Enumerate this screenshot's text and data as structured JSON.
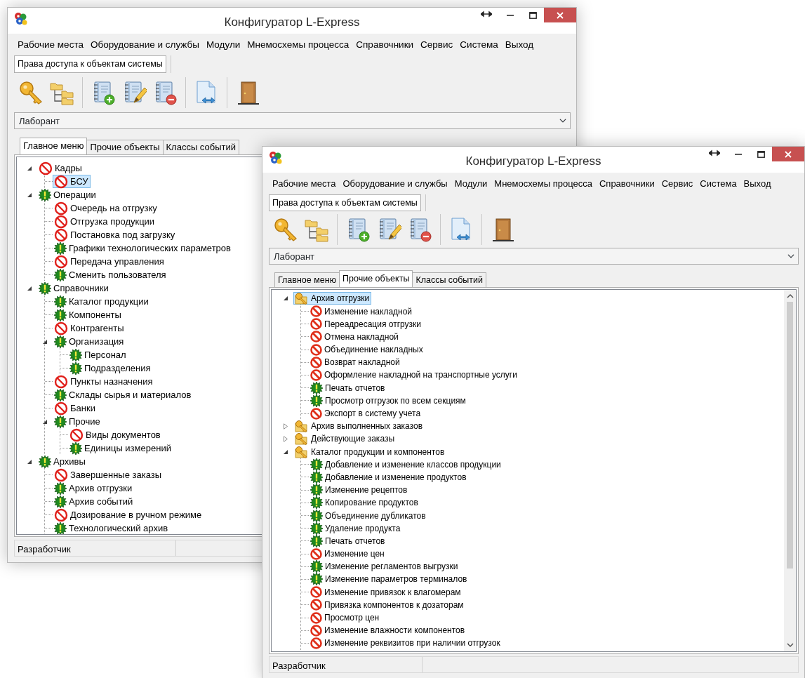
{
  "windows": [
    {
      "title": "Конфигуратор L-Express",
      "menu": [
        "Рабочие места",
        "Оборудование и службы",
        "Модули",
        "Мнемосхемы процесса",
        "Справочники",
        "Сервис",
        "Система",
        "Выход"
      ],
      "doc_tabs": [
        "Права доступа к объектам системы"
      ],
      "role": "Лаборант",
      "tabs": [
        {
          "label": "Главное меню",
          "selected": true
        },
        {
          "label": "Прочие объекты",
          "selected": false
        },
        {
          "label": "Классы событий",
          "selected": false
        }
      ],
      "tree": [
        {
          "label": "Кадры",
          "kind": "denied",
          "selected": false,
          "expanded": true,
          "children": [
            {
              "label": "БСУ",
              "kind": "denied",
              "selected": true
            }
          ]
        },
        {
          "label": "Операции",
          "kind": "allowed",
          "selected": false,
          "expanded": true,
          "children": [
            {
              "label": "Очередь на отгрузку",
              "kind": "denied",
              "selected": false
            },
            {
              "label": "Отгрузка продукции",
              "kind": "denied",
              "selected": false
            },
            {
              "label": "Постановка под загрузку",
              "kind": "denied",
              "selected": false
            },
            {
              "label": "Графики технологических параметров",
              "kind": "allowed",
              "selected": false
            },
            {
              "label": "Передача управления",
              "kind": "denied",
              "selected": false
            },
            {
              "label": "Сменить пользователя",
              "kind": "allowed",
              "selected": false
            }
          ]
        },
        {
          "label": "Справочники",
          "kind": "allowed",
          "selected": false,
          "expanded": true,
          "children": [
            {
              "label": "Каталог продукции",
              "kind": "allowed",
              "selected": false
            },
            {
              "label": "Компоненты",
              "kind": "allowed",
              "selected": false
            },
            {
              "label": "Контрагенты",
              "kind": "denied",
              "selected": false
            },
            {
              "label": "Организация",
              "kind": "allowed",
              "selected": false,
              "expanded": true,
              "children": [
                {
                  "label": "Персонал",
                  "kind": "allowed",
                  "selected": false
                },
                {
                  "label": "Подразделения",
                  "kind": "allowed",
                  "selected": false
                }
              ]
            },
            {
              "label": "Пункты назначения",
              "kind": "denied",
              "selected": false
            },
            {
              "label": "Склады сырья и материалов",
              "kind": "allowed",
              "selected": false
            },
            {
              "label": "Банки",
              "kind": "denied",
              "selected": false
            },
            {
              "label": "Прочие",
              "kind": "allowed",
              "selected": false,
              "expanded": true,
              "children": [
                {
                  "label": "Виды документов",
                  "kind": "denied",
                  "selected": false
                },
                {
                  "label": "Единицы измерений",
                  "kind": "allowed",
                  "selected": false
                }
              ]
            }
          ]
        },
        {
          "label": "Архивы",
          "kind": "allowed",
          "selected": false,
          "expanded": true,
          "children": [
            {
              "label": "Завершенные заказы",
              "kind": "denied",
              "selected": false
            },
            {
              "label": "Архив отгрузки",
              "kind": "allowed",
              "selected": false
            },
            {
              "label": "Архив событий",
              "kind": "allowed",
              "selected": false
            },
            {
              "label": "Дозирование в ручном режиме",
              "kind": "denied",
              "selected": false
            },
            {
              "label": "Технологический архив",
              "kind": "allowed",
              "selected": false
            }
          ]
        }
      ],
      "status_bar": [
        "Разработчик"
      ]
    },
    {
      "title": "Конфигуратор L-Express",
      "menu": [
        "Рабочие места",
        "Оборудование и службы",
        "Модули",
        "Мнемосхемы процесса",
        "Справочники",
        "Сервис",
        "Система",
        "Выход"
      ],
      "doc_tabs": [
        "Права доступа к объектам системы"
      ],
      "role": "Лаборант",
      "scrollbar": true,
      "tabs": [
        {
          "label": "Главное меню",
          "selected": false
        },
        {
          "label": "Прочие объекты",
          "selected": true
        },
        {
          "label": "Классы событий",
          "selected": false
        }
      ],
      "tree": [
        {
          "label": "Архив отгрузки",
          "kind": "key",
          "selected": true,
          "expanded": true,
          "children": [
            {
              "label": "Изменение накладной",
              "kind": "blocked",
              "selected": false
            },
            {
              "label": "Переадресация отгрузки",
              "kind": "blocked",
              "selected": false
            },
            {
              "label": "Отмена накладной",
              "kind": "blocked",
              "selected": false
            },
            {
              "label": "Объединение накладных",
              "kind": "blocked",
              "selected": false
            },
            {
              "label": "Возврат накладной",
              "kind": "blocked",
              "selected": false
            },
            {
              "label": "Оформление накладной на транспортные услуги",
              "kind": "blocked",
              "selected": false
            },
            {
              "label": "Печать отчетов",
              "kind": "allowed",
              "selected": false
            },
            {
              "label": "Просмотр отгрузок по всем секциям",
              "kind": "allowed",
              "selected": false
            },
            {
              "label": "Экспорт в систему учета",
              "kind": "blocked",
              "selected": false
            }
          ]
        },
        {
          "label": "Архив выполненных заказов",
          "kind": "key",
          "selected": false,
          "expanded": false
        },
        {
          "label": "Действующие заказы",
          "kind": "key",
          "selected": false,
          "expanded": false
        },
        {
          "label": "Каталог продукции и компонентов",
          "kind": "key",
          "selected": false,
          "expanded": true,
          "children": [
            {
              "label": "Добавление и изменение классов продукции",
              "kind": "allowed",
              "selected": false
            },
            {
              "label": "Добавление и изменение продуктов",
              "kind": "allowed",
              "selected": false
            },
            {
              "label": "Изменение рецептов",
              "kind": "allowed",
              "selected": false
            },
            {
              "label": "Копирование продуктов",
              "kind": "allowed",
              "selected": false
            },
            {
              "label": "Объединение дубликатов",
              "kind": "allowed",
              "selected": false
            },
            {
              "label": "Удаление продукта",
              "kind": "allowed",
              "selected": false
            },
            {
              "label": "Печать отчетов",
              "kind": "allowed",
              "selected": false
            },
            {
              "label": "Изменение цен",
              "kind": "blocked",
              "selected": false
            },
            {
              "label": "Изменение регламентов выгрузки",
              "kind": "allowed",
              "selected": false
            },
            {
              "label": "Изменение параметров терминалов",
              "kind": "allowed",
              "selected": false
            },
            {
              "label": "Изменение привязок к влагомерам",
              "kind": "blocked",
              "selected": false
            },
            {
              "label": "Привязка компонентов к дозаторам",
              "kind": "blocked",
              "selected": false
            },
            {
              "label": "Просмотр цен",
              "kind": "blocked",
              "selected": false
            },
            {
              "label": "Изменение влажности компонентов",
              "kind": "blocked",
              "selected": false
            },
            {
              "label": "Изменение реквизитов при наличии отгрузок",
              "kind": "blocked",
              "selected": false
            }
          ]
        }
      ],
      "status_bar": [
        "Разработчик"
      ]
    }
  ]
}
